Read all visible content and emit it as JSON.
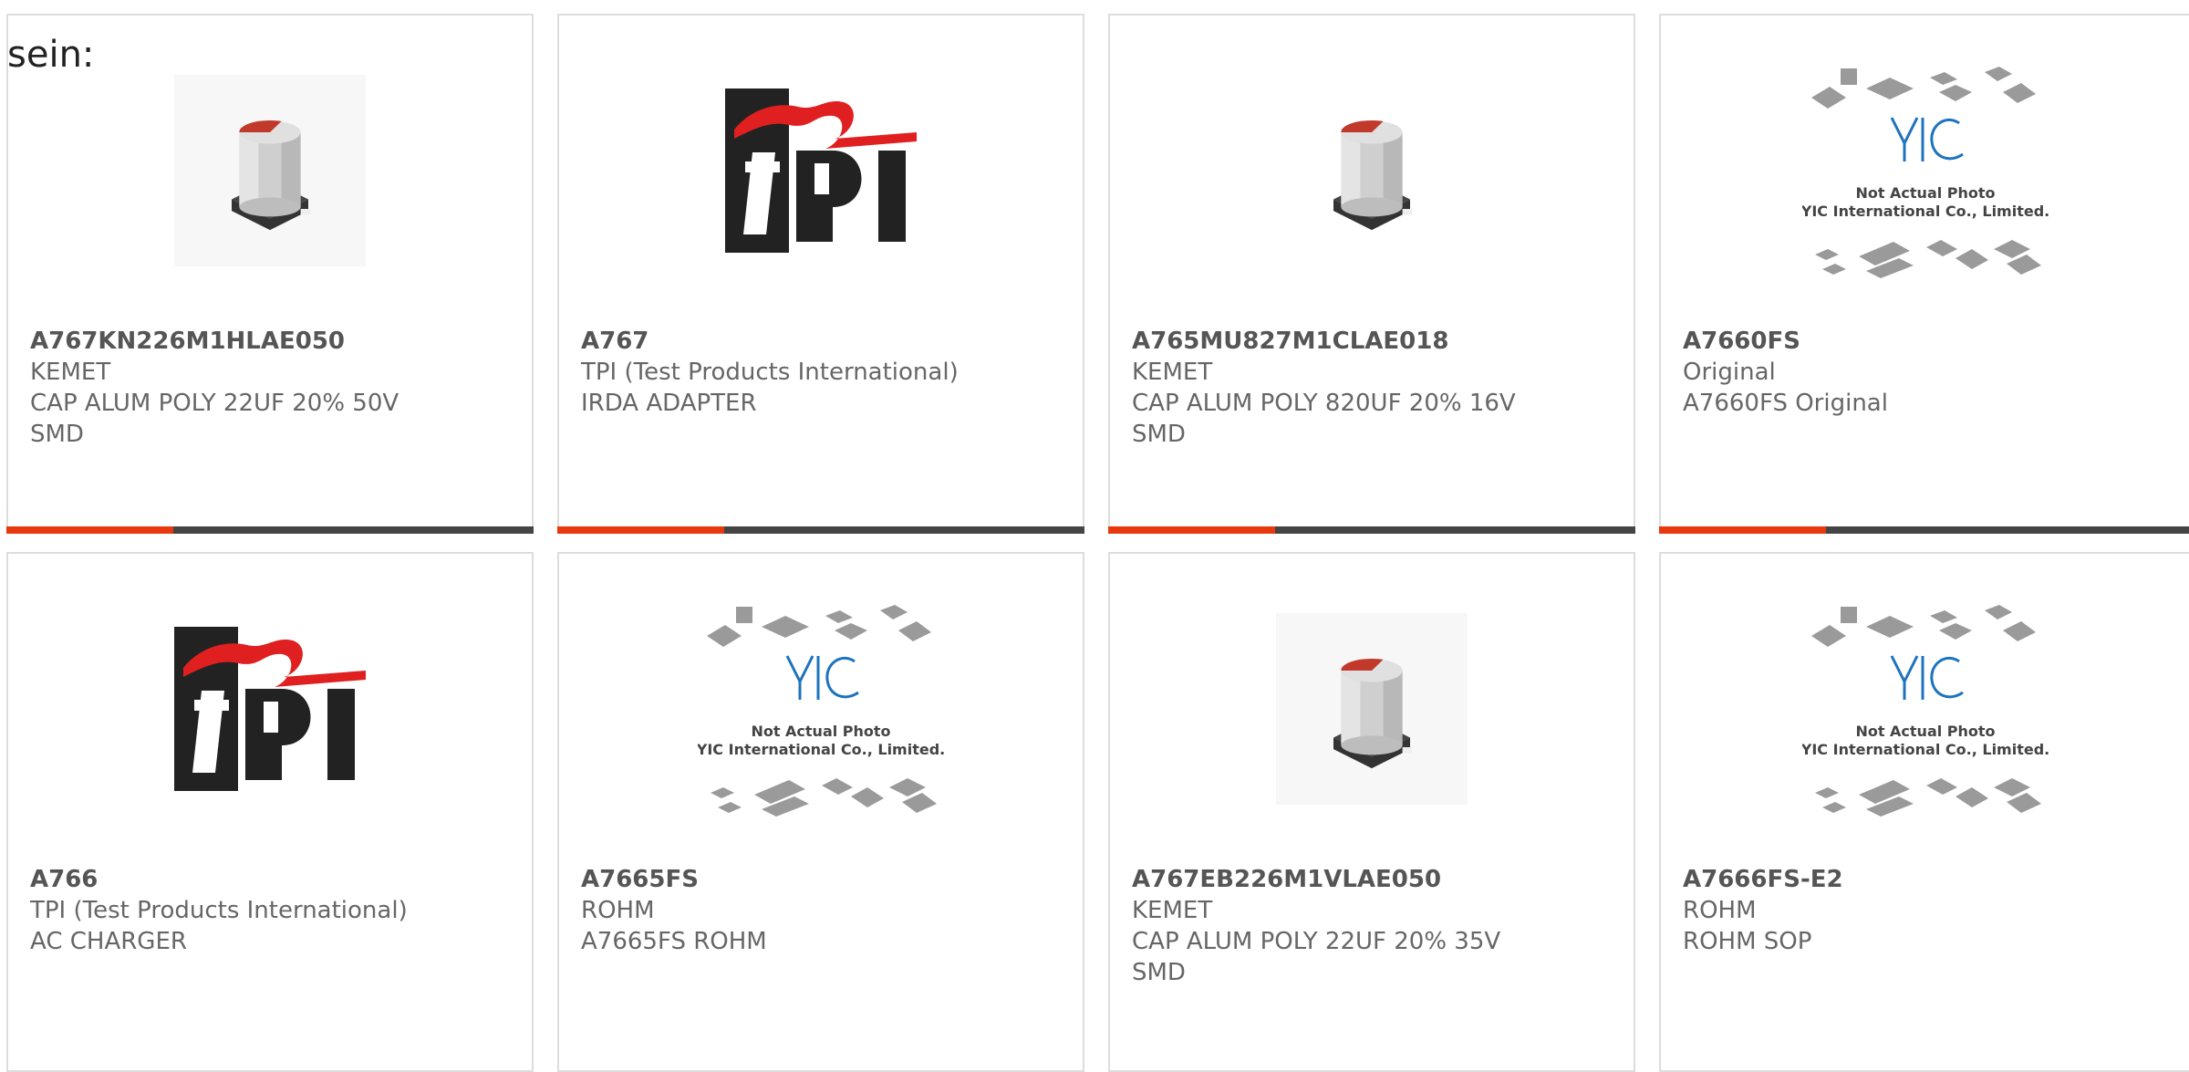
{
  "intro_text": "sein:",
  "colors": {
    "accent": "#e8380d",
    "bar": "#444444",
    "border": "#dddddd"
  },
  "products": [
    {
      "part": "A767KN226M1HLAE050",
      "maker": "KEMET",
      "desc_line1": "CAP ALUM POLY 22UF 20% 50V",
      "desc_line2": "SMD",
      "image": "capacitor-icon"
    },
    {
      "part": "A767",
      "maker": "TPI (Test Products International)",
      "desc_line1": "IRDA ADAPTER",
      "desc_line2": "",
      "image": "tpi-logo"
    },
    {
      "part": "A765MU827M1CLAE018",
      "maker": "KEMET",
      "desc_line1": "CAP ALUM POLY 820UF 20% 16V",
      "desc_line2": "SMD",
      "image": "capacitor-icon"
    },
    {
      "part": "A7660FS",
      "maker": "Original",
      "desc_line1": "A7660FS Original",
      "desc_line2": "",
      "image": "yic-placeholder"
    },
    {
      "part": "A766",
      "maker": "TPI (Test Products International)",
      "desc_line1": "AC CHARGER",
      "desc_line2": "",
      "image": "tpi-logo"
    },
    {
      "part": "A7665FS",
      "maker": "ROHM",
      "desc_line1": "A7665FS ROHM",
      "desc_line2": "",
      "image": "yic-placeholder"
    },
    {
      "part": "A767EB226M1VLAE050",
      "maker": "KEMET",
      "desc_line1": "CAP ALUM POLY 22UF 20% 35V",
      "desc_line2": "SMD",
      "image": "capacitor-icon"
    },
    {
      "part": "A7666FS-E2",
      "maker": "ROHM",
      "desc_line1": "ROHM SOP",
      "desc_line2": "",
      "image": "yic-placeholder"
    }
  ],
  "yic_text": {
    "logo": "YIC",
    "line1": "Not Actual Photo",
    "line2": "YIC International Co., Limited."
  }
}
